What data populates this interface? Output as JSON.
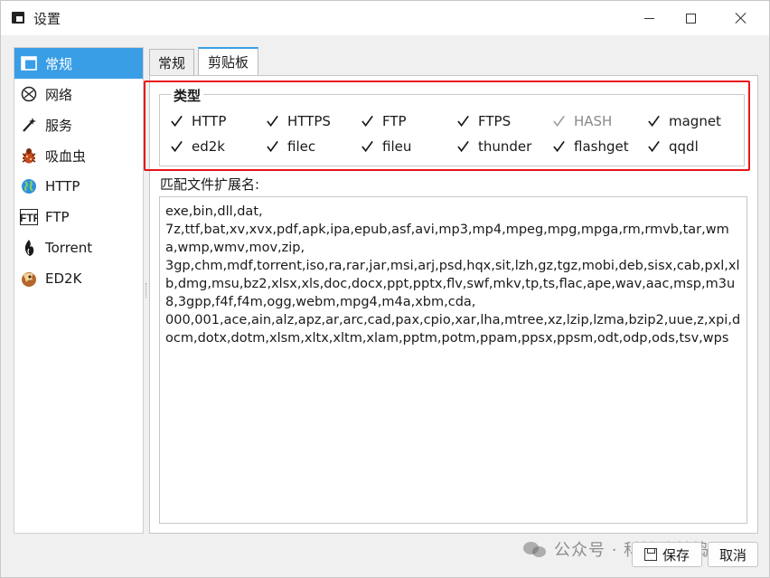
{
  "window": {
    "title": "设置",
    "controls": {
      "minimize": "",
      "maximize": "",
      "close": ""
    }
  },
  "sidebar": {
    "items": [
      {
        "label": "常规",
        "icon": "general-settings-icon",
        "selected": true
      },
      {
        "label": "网络",
        "icon": "network-icon",
        "selected": false
      },
      {
        "label": "服务",
        "icon": "magic-wand-icon",
        "selected": false
      },
      {
        "label": "吸血虫",
        "icon": "bug-icon",
        "selected": false
      },
      {
        "label": "HTTP",
        "icon": "globe-icon",
        "selected": false
      },
      {
        "label": "FTP",
        "icon": "ftp-icon",
        "selected": false
      },
      {
        "label": "Torrent",
        "icon": "torrent-icon",
        "selected": false
      },
      {
        "label": "ED2K",
        "icon": "ed2k-icon",
        "selected": false
      }
    ]
  },
  "tabs": [
    {
      "label": "常规",
      "active": false
    },
    {
      "label": "剪贴板",
      "active": true
    }
  ],
  "types_group": {
    "title": "类型",
    "items": [
      {
        "label": "HTTP",
        "checked": true,
        "enabled": true
      },
      {
        "label": "HTTPS",
        "checked": true,
        "enabled": true
      },
      {
        "label": "FTP",
        "checked": true,
        "enabled": true
      },
      {
        "label": "FTPS",
        "checked": true,
        "enabled": true
      },
      {
        "label": "HASH",
        "checked": false,
        "enabled": false
      },
      {
        "label": "magnet",
        "checked": true,
        "enabled": true
      },
      {
        "label": "ed2k",
        "checked": true,
        "enabled": true
      },
      {
        "label": "filec",
        "checked": true,
        "enabled": true
      },
      {
        "label": "fileu",
        "checked": true,
        "enabled": true
      },
      {
        "label": "thunder",
        "checked": true,
        "enabled": true
      },
      {
        "label": "flashget",
        "checked": true,
        "enabled": true
      },
      {
        "label": "qqdl",
        "checked": true,
        "enabled": true
      }
    ]
  },
  "extensions": {
    "label": "匹配文件扩展名:",
    "value": "exe,bin,dll,dat,\n7z,ttf,bat,xv,xvx,pdf,apk,ipa,epub,asf,avi,mp3,mp4,mpeg,mpg,mpga,rm,rmvb,tar,wma,wmp,wmv,mov,zip,\n3gp,chm,mdf,torrent,iso,ra,rar,jar,msi,arj,psd,hqx,sit,lzh,gz,tgz,mobi,deb,sisx,cab,pxl,xlb,dmg,msu,bz2,xlsx,xls,doc,docx,ppt,pptx,flv,swf,mkv,tp,ts,flac,ape,wav,aac,msp,m3u8,3gpp,f4f,f4m,ogg,webm,mpg4,m4a,xbm,cda,\n000,001,ace,ain,alz,apz,ar,arc,cad,pax,cpio,xar,lha,mtree,xz,lzip,lzma,bzip2,uue,z,xpi,docm,dotx,dotm,xlsm,xltx,xltm,xlam,pptm,potm,ppam,ppsx,ppsm,odt,odp,ods,tsv,wps"
  },
  "buttons": {
    "save": "保存",
    "cancel": "取消"
  },
  "watermark": {
    "text": "公众号 · 科技睛鼓捣"
  },
  "colors": {
    "accent": "#3a9ee6",
    "highlight_frame": "#e8161a"
  }
}
